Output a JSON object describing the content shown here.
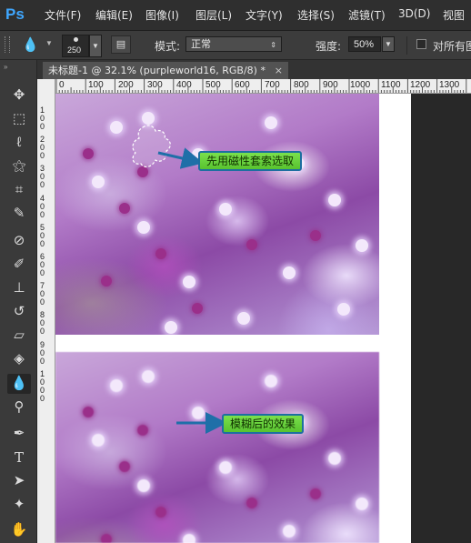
{
  "app": {
    "logo": "Ps"
  },
  "menu": [
    "文件(F)",
    "编辑(E)",
    "图像(I)",
    "图层(L)",
    "文字(Y)",
    "选择(S)",
    "滤镜(T)",
    "3D(D)",
    "视图"
  ],
  "options": {
    "brush_size": "250",
    "mode_label": "模式:",
    "mode_value": "正常",
    "strength_label": "强度:",
    "strength_value": "50%",
    "all_layers_label": "对所有图"
  },
  "tab": {
    "title": "未标题-1 @ 32.1% (purpleworld16, RGB/8) *",
    "close": "×"
  },
  "ruler_h": [
    "0",
    "100",
    "200",
    "300",
    "400",
    "500",
    "600",
    "700",
    "800",
    "900",
    "1000",
    "1100",
    "1200",
    "1300"
  ],
  "ruler_v": [
    "1",
    "0",
    "0",
    "2",
    "0",
    "0",
    "3",
    "0",
    "0",
    "4",
    "0",
    "0",
    "5",
    "0",
    "0",
    "6",
    "0",
    "0",
    "7",
    "0",
    "0",
    "8",
    "0",
    "0",
    "9",
    "0",
    "0",
    "1",
    "0",
    "0",
    "0"
  ],
  "annotations": {
    "top": "先用磁性套索选取",
    "bottom": "模糊后的效果"
  },
  "colors": {
    "callout_fill": "#6fd43f",
    "callout_border": "#1d6fa0",
    "arrow": "#1f6fa8"
  },
  "tools": [
    "move-icon",
    "marquee-icon",
    "lasso-icon",
    "magic-wand-icon",
    "crop-icon",
    "eyedropper-icon",
    "healing-icon",
    "brush-icon",
    "stamp-icon",
    "history-brush-icon",
    "eraser-icon",
    "paint-bucket-icon",
    "blur-icon",
    "dodge-icon",
    "pen-icon",
    "type-icon",
    "path-select-icon",
    "shape-icon",
    "hand-icon"
  ]
}
